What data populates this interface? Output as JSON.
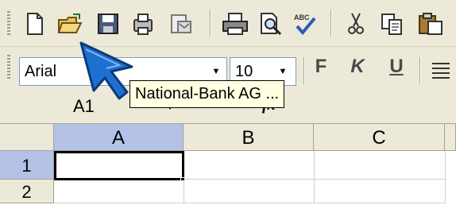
{
  "toolbar": {
    "icons": [
      "new-icon",
      "open-icon",
      "save-icon",
      "permission-icon",
      "email-icon",
      "print-icon",
      "print-preview-icon",
      "spelling-icon",
      "cut-icon",
      "copy-icon",
      "paste-icon"
    ]
  },
  "format": {
    "font": "Arial",
    "size": "10",
    "bold": "F",
    "italic": "K",
    "underline": "U"
  },
  "formula": {
    "name_box": "A1",
    "fx": "fx"
  },
  "tooltip": "National-Bank AG ...",
  "grid": {
    "columns": [
      "A",
      "B",
      "C"
    ],
    "rows": [
      "1",
      "2"
    ]
  },
  "colors": {
    "selection": "#b4c2e8",
    "cursor": "#1f6fd1",
    "tooltip_bg": "#ffffe1"
  }
}
